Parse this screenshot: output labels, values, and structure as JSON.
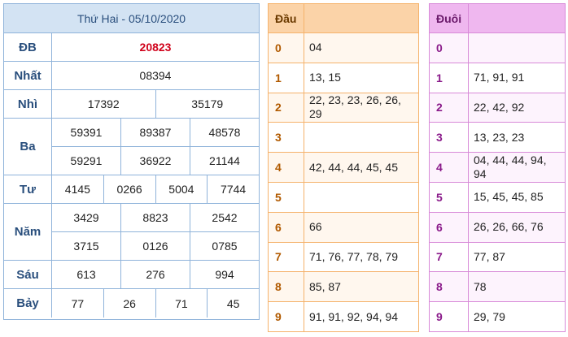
{
  "results": {
    "header": "Thứ Hai - 05/10/2020",
    "prizes": [
      {
        "label": "ĐB",
        "rows": [
          [
            "20823"
          ]
        ],
        "special": true
      },
      {
        "label": "Nhất",
        "rows": [
          [
            "08394"
          ]
        ]
      },
      {
        "label": "Nhì",
        "rows": [
          [
            "17392",
            "35179"
          ]
        ]
      },
      {
        "label": "Ba",
        "rows": [
          [
            "59391",
            "89387",
            "48578"
          ],
          [
            "59291",
            "36922",
            "21144"
          ]
        ]
      },
      {
        "label": "Tư",
        "rows": [
          [
            "4145",
            "0266",
            "5004",
            "7744"
          ]
        ]
      },
      {
        "label": "Năm",
        "rows": [
          [
            "3429",
            "8823",
            "2542"
          ],
          [
            "3715",
            "0126",
            "0785"
          ]
        ]
      },
      {
        "label": "Sáu",
        "rows": [
          [
            "613",
            "276",
            "994"
          ]
        ]
      },
      {
        "label": "Bảy",
        "rows": [
          [
            "77",
            "26",
            "71",
            "45"
          ]
        ]
      }
    ]
  },
  "dau": {
    "header": "Đầu",
    "rows": [
      {
        "key": "0",
        "value": "04"
      },
      {
        "key": "1",
        "value": "13, 15"
      },
      {
        "key": "2",
        "value": "22, 23, 23, 26, 26, 29"
      },
      {
        "key": "3",
        "value": ""
      },
      {
        "key": "4",
        "value": "42, 44, 44, 45, 45"
      },
      {
        "key": "5",
        "value": ""
      },
      {
        "key": "6",
        "value": "66"
      },
      {
        "key": "7",
        "value": "71, 76, 77, 78, 79"
      },
      {
        "key": "8",
        "value": "85, 87"
      },
      {
        "key": "9",
        "value": "91, 91, 92, 94, 94"
      }
    ]
  },
  "duoi": {
    "header": "Đuôi",
    "rows": [
      {
        "key": "0",
        "value": ""
      },
      {
        "key": "1",
        "value": "71, 91, 91"
      },
      {
        "key": "2",
        "value": "22, 42, 92"
      },
      {
        "key": "3",
        "value": "13, 23, 23"
      },
      {
        "key": "4",
        "value": "04, 44, 44, 94, 94"
      },
      {
        "key": "5",
        "value": "15, 45, 45, 85"
      },
      {
        "key": "6",
        "value": "26, 26, 66, 76"
      },
      {
        "key": "7",
        "value": "77, 87"
      },
      {
        "key": "8",
        "value": "78"
      },
      {
        "key": "9",
        "value": "29, 79"
      }
    ]
  },
  "colors": {
    "results_border": "#8fb3da",
    "results_header_bg": "#d3e3f3",
    "special_prize": "#d0021b",
    "dau_border": "#f5b26b",
    "dau_header_bg": "#fbd3a8",
    "duoi_border": "#d88ad8",
    "duoi_header_bg": "#efb7ef"
  }
}
